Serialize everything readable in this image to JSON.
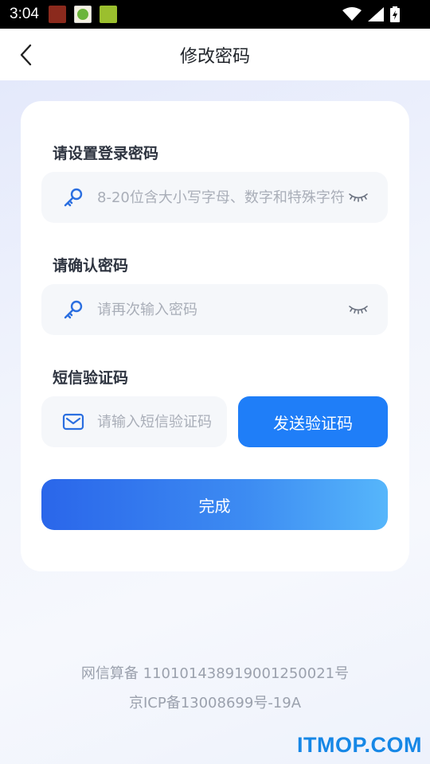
{
  "status_bar": {
    "time": "3:04"
  },
  "header": {
    "title": "修改密码"
  },
  "form": {
    "password_label": "请设置登录密码",
    "password_placeholder": "8-20位含大小写字母、数字和特殊字符",
    "confirm_label": "请确认密码",
    "confirm_placeholder": "请再次输入密码",
    "sms_label": "短信验证码",
    "sms_placeholder": "请输入短信验证码",
    "send_code_label": "发送验证码",
    "submit_label": "完成"
  },
  "footer": {
    "line1": "网信算备 110101438919001250021号",
    "line2": "京ICP备13008699号-19A"
  },
  "watermark": "ITMOP.COM",
  "colors": {
    "primary": "#1f7ef8",
    "icon_blue": "#2b6fe0",
    "label": "#2e3440",
    "placeholder": "#a9aeb8"
  }
}
